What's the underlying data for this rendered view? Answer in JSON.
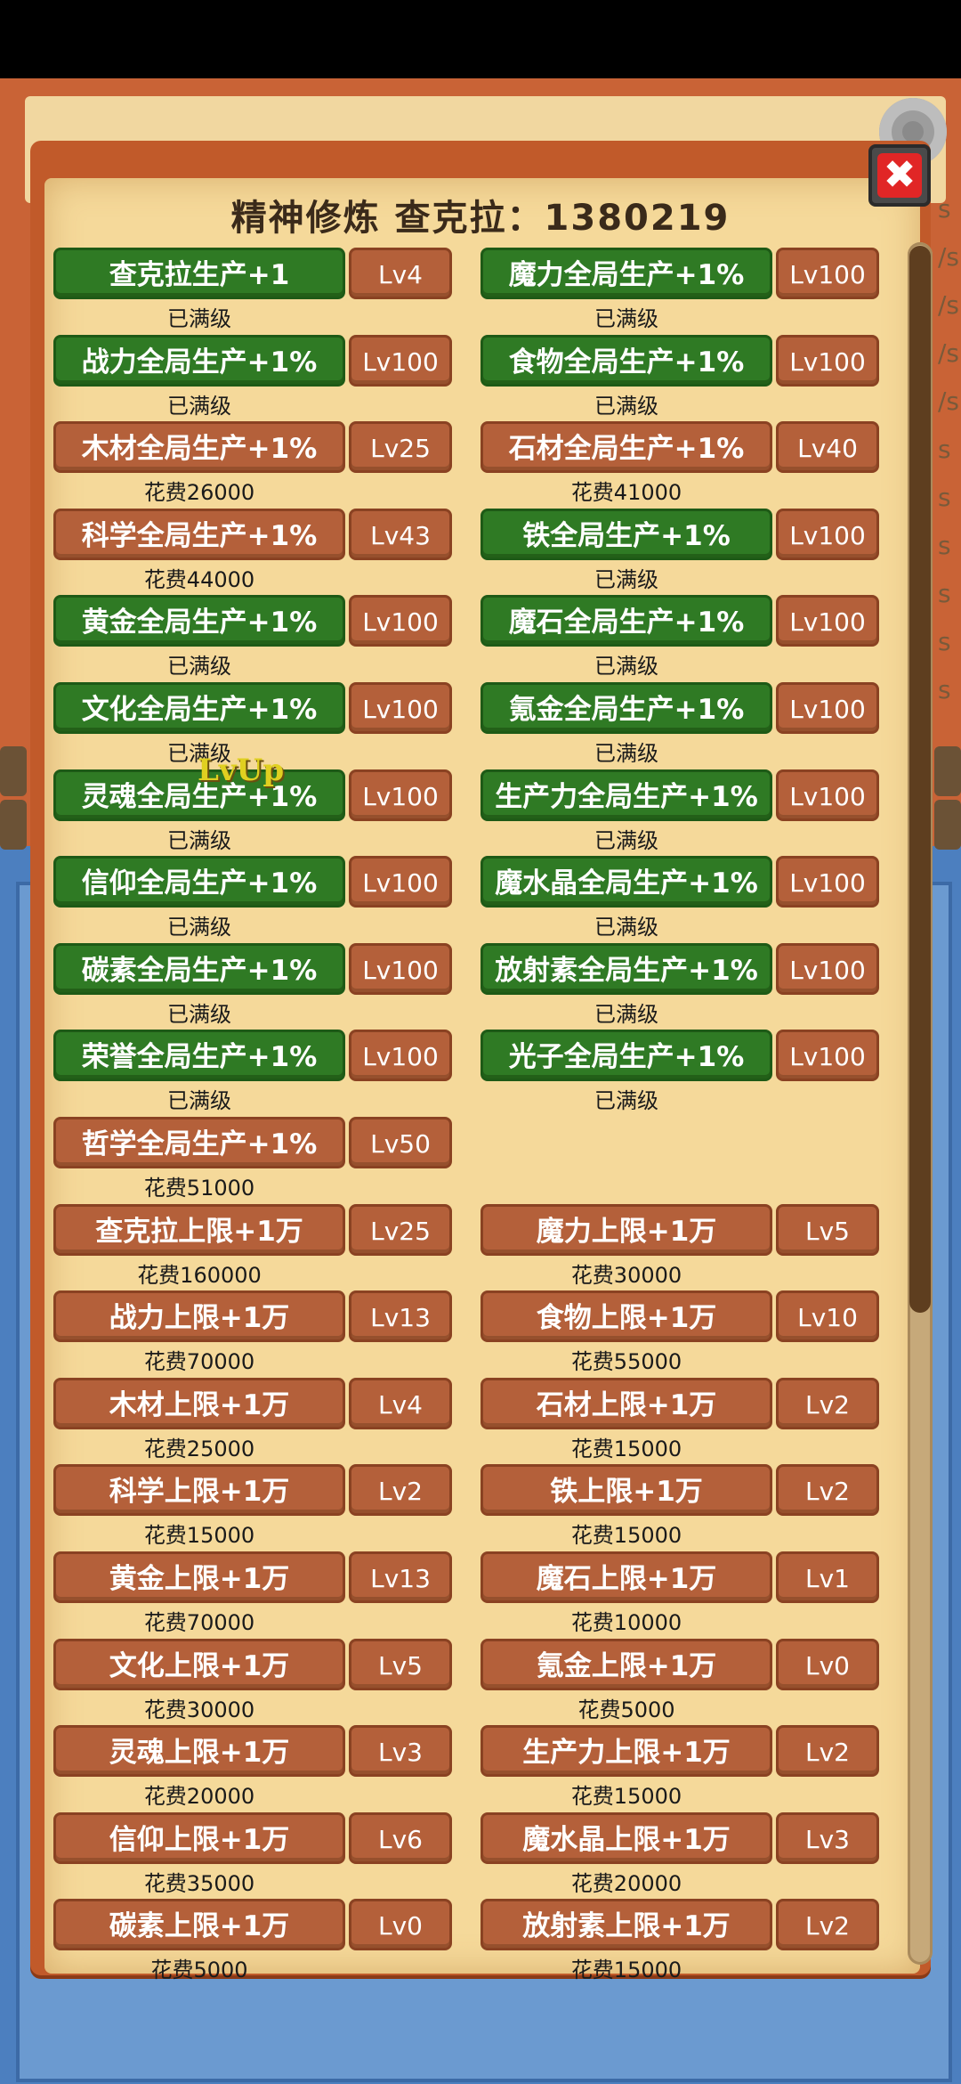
{
  "title": "精神修炼 查克拉：1380219",
  "lvup_text": "LvUp",
  "close_label": "✖",
  "right_letters": [
    "s",
    "/s",
    "/s",
    "/s",
    "/s",
    "s",
    "s",
    "s",
    "s",
    "s",
    "s"
  ],
  "upgrades": [
    {
      "label": "查克拉生产+1",
      "level": "Lv4",
      "status": "已满级",
      "style": "green"
    },
    {
      "label": "魔力全局生产+1%",
      "level": "Lv100",
      "status": "已满级",
      "style": "green"
    },
    {
      "label": "战力全局生产+1%",
      "level": "Lv100",
      "status": "已满级",
      "style": "green"
    },
    {
      "label": "食物全局生产+1%",
      "level": "Lv100",
      "status": "已满级",
      "style": "green"
    },
    {
      "label": "木材全局生产+1%",
      "level": "Lv25",
      "status": "花费26000",
      "style": "wood"
    },
    {
      "label": "石材全局生产+1%",
      "level": "Lv40",
      "status": "花费41000",
      "style": "wood"
    },
    {
      "label": "科学全局生产+1%",
      "level": "Lv43",
      "status": "花费44000",
      "style": "wood"
    },
    {
      "label": "铁全局生产+1%",
      "level": "Lv100",
      "status": "已满级",
      "style": "green"
    },
    {
      "label": "黄金全局生产+1%",
      "level": "Lv100",
      "status": "已满级",
      "style": "green"
    },
    {
      "label": "魔石全局生产+1%",
      "level": "Lv100",
      "status": "已满级",
      "style": "green"
    },
    {
      "label": "文化全局生产+1%",
      "level": "Lv100",
      "status": "已满级",
      "style": "green"
    },
    {
      "label": "氪金全局生产+1%",
      "level": "Lv100",
      "status": "已满级",
      "style": "green"
    },
    {
      "label": "灵魂全局生产+1%",
      "level": "Lv100",
      "status": "已满级",
      "style": "green"
    },
    {
      "label": "生产力全局生产+1%",
      "level": "Lv100",
      "status": "已满级",
      "style": "green"
    },
    {
      "label": "信仰全局生产+1%",
      "level": "Lv100",
      "status": "已满级",
      "style": "green"
    },
    {
      "label": "魔水晶全局生产+1%",
      "level": "Lv100",
      "status": "已满级",
      "style": "green"
    },
    {
      "label": "碳素全局生产+1%",
      "level": "Lv100",
      "status": "已满级",
      "style": "green"
    },
    {
      "label": "放射素全局生产+1%",
      "level": "Lv100",
      "status": "已满级",
      "style": "green"
    },
    {
      "label": "荣誉全局生产+1%",
      "level": "Lv100",
      "status": "已满级",
      "style": "green"
    },
    {
      "label": "光子全局生产+1%",
      "level": "Lv100",
      "status": "已满级",
      "style": "green"
    },
    {
      "label": "哲学全局生产+1%",
      "level": "Lv50",
      "status": "花费51000",
      "style": "wood"
    },
    null,
    {
      "label": "查克拉上限+1万",
      "level": "Lv25",
      "status": "花费160000",
      "style": "wood"
    },
    {
      "label": "魔力上限+1万",
      "level": "Lv5",
      "status": "花费30000",
      "style": "wood"
    },
    {
      "label": "战力上限+1万",
      "level": "Lv13",
      "status": "花费70000",
      "style": "wood"
    },
    {
      "label": "食物上限+1万",
      "level": "Lv10",
      "status": "花费55000",
      "style": "wood"
    },
    {
      "label": "木材上限+1万",
      "level": "Lv4",
      "status": "花费25000",
      "style": "wood"
    },
    {
      "label": "石材上限+1万",
      "level": "Lv2",
      "status": "花费15000",
      "style": "wood"
    },
    {
      "label": "科学上限+1万",
      "level": "Lv2",
      "status": "花费15000",
      "style": "wood"
    },
    {
      "label": "铁上限+1万",
      "level": "Lv2",
      "status": "花费15000",
      "style": "wood"
    },
    {
      "label": "黄金上限+1万",
      "level": "Lv13",
      "status": "花费70000",
      "style": "wood"
    },
    {
      "label": "魔石上限+1万",
      "level": "Lv1",
      "status": "花费10000",
      "style": "wood"
    },
    {
      "label": "文化上限+1万",
      "level": "Lv5",
      "status": "花费30000",
      "style": "wood"
    },
    {
      "label": "氪金上限+1万",
      "level": "Lv0",
      "status": "花费5000",
      "style": "wood"
    },
    {
      "label": "灵魂上限+1万",
      "level": "Lv3",
      "status": "花费20000",
      "style": "wood"
    },
    {
      "label": "生产力上限+1万",
      "level": "Lv2",
      "status": "花费15000",
      "style": "wood"
    },
    {
      "label": "信仰上限+1万",
      "level": "Lv6",
      "status": "花费35000",
      "style": "wood"
    },
    {
      "label": "魔水晶上限+1万",
      "level": "Lv3",
      "status": "花费20000",
      "style": "wood"
    },
    {
      "label": "碳素上限+1万",
      "level": "Lv0",
      "status": "花费5000",
      "style": "wood"
    },
    {
      "label": "放射素上限+1万",
      "level": "Lv2",
      "status": "花费15000",
      "style": "wood"
    }
  ]
}
